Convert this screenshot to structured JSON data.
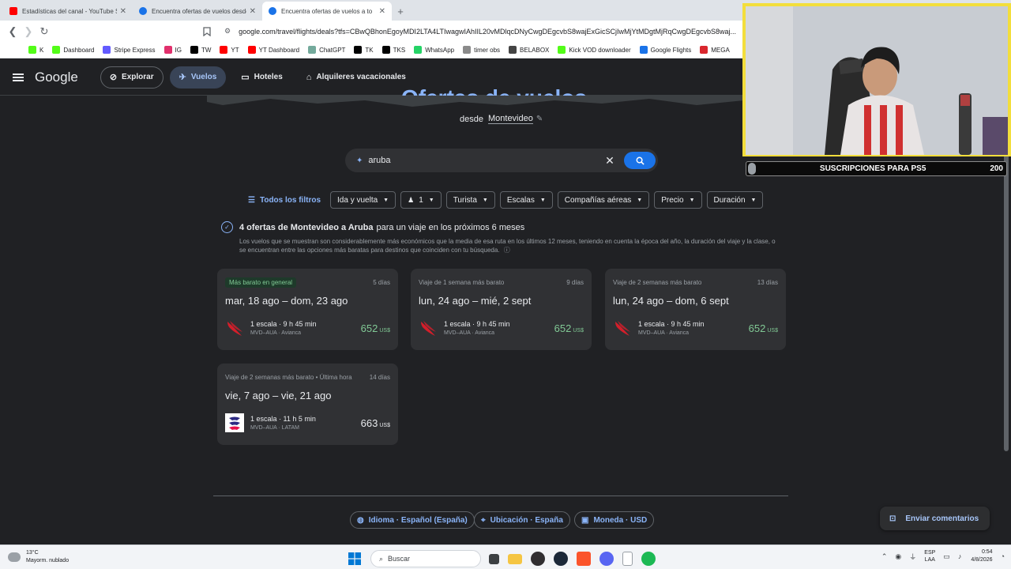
{
  "browser": {
    "tabs": [
      {
        "title": "Estadísticas del canal - YouTube Studio",
        "color": "#ff0000",
        "active": false
      },
      {
        "title": "Encuentra ofertas de vuelos desde M",
        "color": "#1a73e8",
        "active": false
      },
      {
        "title": "Encuentra ofertas de vuelos a to",
        "color": "#1a73e8",
        "active": true
      }
    ],
    "url": "google.com/travel/flights/deals?tfs=CBwQBhonEgoyMDI2LTA4LTIwagwIAhIIL20vMDlqcDNyCwgDEgcvbS8wajExGicSCjIwMjYtMDgtMjRqCwgDEgcvbS8waj...",
    "bookmarks": [
      {
        "label": "K",
        "color": "#53fc18"
      },
      {
        "label": "Dashboard",
        "color": "#53fc18"
      },
      {
        "label": "Stripe Express",
        "color": "#635bff"
      },
      {
        "label": "IG",
        "color": "#e1306c"
      },
      {
        "label": "TW",
        "color": "#000000"
      },
      {
        "label": "YT",
        "color": "#ff0000"
      },
      {
        "label": "YT Dashboard",
        "color": "#ff0000"
      },
      {
        "label": "ChatGPT",
        "color": "#74aa9c"
      },
      {
        "label": "TK",
        "color": "#000000"
      },
      {
        "label": "TKS",
        "color": "#000000"
      },
      {
        "label": "WhatsApp",
        "color": "#25d366"
      },
      {
        "label": "timer obs",
        "color": "#8a8a8a"
      },
      {
        "label": "BELABOX",
        "color": "#444444"
      },
      {
        "label": "Kick VOD downloader",
        "color": "#53fc18"
      },
      {
        "label": "Google Flights",
        "color": "#1a73e8"
      },
      {
        "label": "MEGA",
        "color": "#d9272e"
      }
    ]
  },
  "header": {
    "logo": "Google",
    "nav": [
      {
        "label": "Explorar",
        "icon": "explore-icon",
        "active": false
      },
      {
        "label": "Vuelos",
        "icon": "flight-icon",
        "active": true
      },
      {
        "label": "Hoteles",
        "icon": "hotel-icon",
        "active": false
      },
      {
        "label": "Alquileres vacacionales",
        "icon": "home-icon",
        "active": false
      }
    ]
  },
  "main": {
    "heading": "Ofertas de vuelos",
    "origin_prefix": "desde",
    "origin_city": "Montevideo",
    "search_value": "aruba",
    "filters": {
      "all_label": "Todos los filtros",
      "chips": [
        "Ida y vuelta",
        "1",
        "Turista",
        "Escalas",
        "Compañías aéreas",
        "Precio",
        "Duración"
      ]
    },
    "summary": {
      "bold": "4 ofertas de Montevideo a Aruba",
      "rest": "para un viaje en los próximos 6 meses",
      "description": "Los vuelos que se muestran son considerablemente más económicos que la media de esa ruta en los últimos 12 meses, teniendo en cuenta la época del año, la duración del viaje y la clase, o se encuentran entre las opciones más baratas para destinos que coinciden con tu búsqueda."
    },
    "deals": [
      {
        "tag": "Más barato en general",
        "duration": "5 días",
        "dates": "mar, 18 ago – dom, 23 ago",
        "stops": "1 escala · 9 h 45 min",
        "route": "MVD–AUA · Avianca",
        "price": "652",
        "currency": "US$",
        "airline_color": "#d41e2a",
        "price_color": "#81c995"
      },
      {
        "tag": "Viaje de 1 semana más barato",
        "duration": "9 días",
        "dates": "lun, 24 ago – mié, 2 sept",
        "stops": "1 escala · 9 h 45 min",
        "route": "MVD–AUA · Avianca",
        "price": "652",
        "currency": "US$",
        "airline_color": "#d41e2a",
        "price_color": "#81c995"
      },
      {
        "tag": "Viaje de 2 semanas más barato",
        "duration": "13 días",
        "dates": "lun, 24 ago – dom, 6 sept",
        "stops": "1 escala · 9 h 45 min",
        "route": "MVD–AUA · Avianca",
        "price": "652",
        "currency": "US$",
        "airline_color": "#d41e2a",
        "price_color": "#81c995"
      },
      {
        "tag": "Viaje de 2 semanas más barato • Última hora",
        "duration": "14 días",
        "dates": "vie, 7 ago – vie, 21 ago",
        "stops": "1 escala · 11 h 5 min",
        "route": "MVD–AUA · LATAM",
        "price": "663",
        "currency": "US$",
        "airline_color": "#2d2a83",
        "price_color": "#e8eaed"
      }
    ]
  },
  "footer": {
    "language": "Idioma · Español (España)",
    "location": "Ubicación · España",
    "currency": "Moneda · USD",
    "feedback": "Enviar comentarios"
  },
  "overlay": {
    "subs_label": "SUSCRIPCIONES PARA PS5",
    "subs_value": "200"
  },
  "taskbar": {
    "temp": "13°C",
    "weather": "Mayorm. nublado",
    "search": "Buscar",
    "lang": "ESP",
    "lang2": "LAA",
    "time": "0:54",
    "date": "4/8/2026"
  }
}
